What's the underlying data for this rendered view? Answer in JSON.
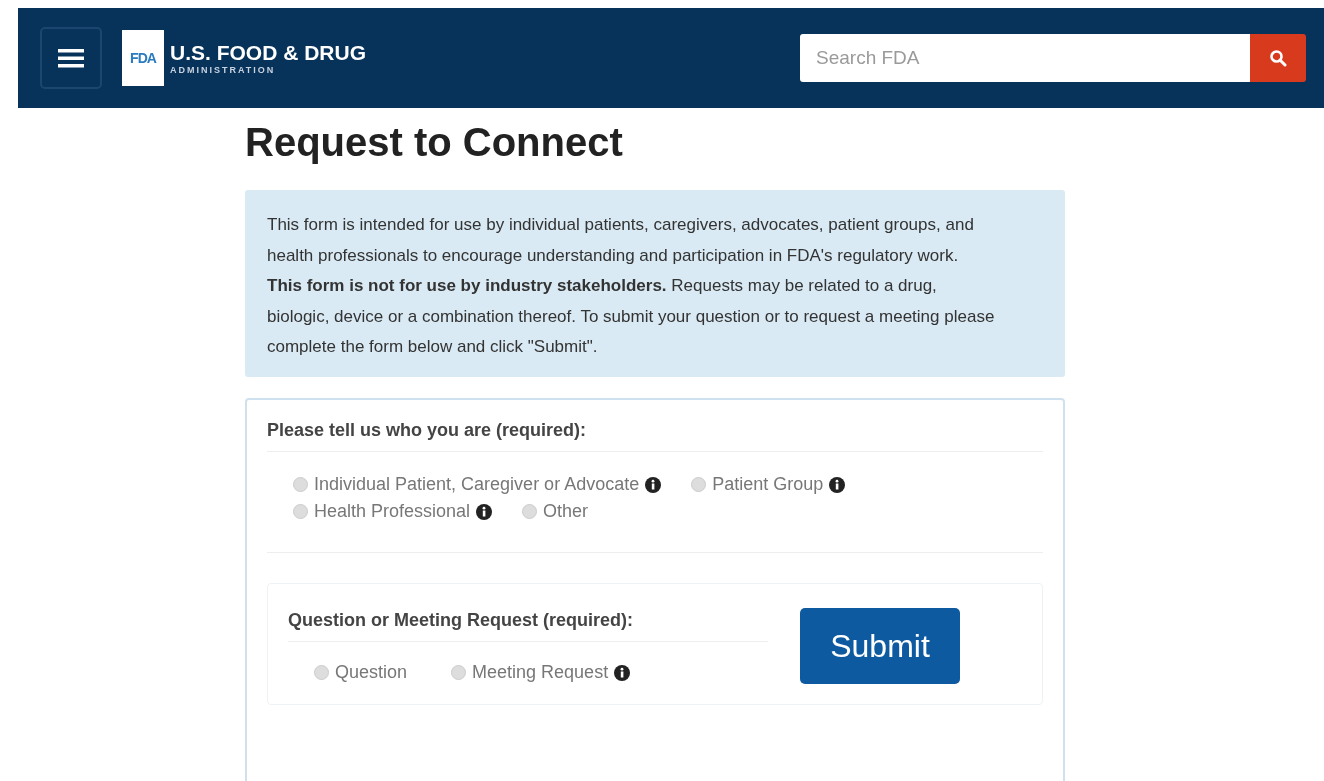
{
  "header": {
    "logo_mark": "FDA",
    "title": "U.S. FOOD & DRUG",
    "subtitle": "ADMINISTRATION",
    "search": {
      "placeholder": "Search FDA"
    }
  },
  "page_title": "Request to Connect",
  "intro": "This form is intended for use by individual patients, caregivers, advocates, patient groups, and health professionals to encourage understanding and participation in FDA's regulatory work. **This form is not for use by industry stakeholders.** Requests may be related to a drug, biologic, device or a combination thereof. To submit your question or to request a meeting please complete the form below and click \"Submit\".",
  "who_section": {
    "label": "Please tell us who you are (required):",
    "options": [
      {
        "label": "Individual Patient, Caregiver or Advocate",
        "selected": false,
        "info": true
      },
      {
        "label": "Patient Group",
        "selected": false,
        "info": true
      },
      {
        "label": "Health Professional",
        "selected": false,
        "info": true
      },
      {
        "label": "Other",
        "selected": false,
        "info": false
      }
    ]
  },
  "request_section": {
    "label": "Question or Meeting Request (required):",
    "options": [
      {
        "label": "Question",
        "selected": false,
        "info": false
      },
      {
        "label": "Meeting Request",
        "selected": false,
        "info": true
      }
    ]
  },
  "submit_button": "Submit"
}
